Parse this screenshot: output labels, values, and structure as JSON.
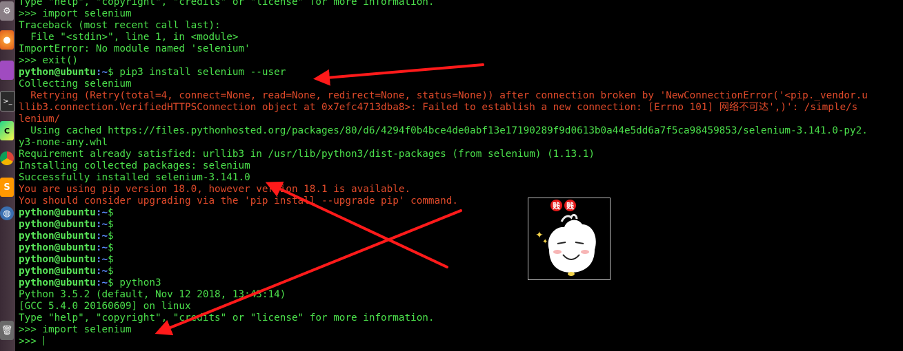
{
  "launcher": {
    "icons": [
      "settings-icon",
      "firefox-icon",
      "purple-app-icon",
      "terminal-app-icon",
      "pycharm-icon",
      "chrome-icon",
      "sublime-icon",
      "network-icon",
      "trash-icon"
    ]
  },
  "terminal": {
    "user_host": "python@ubuntu",
    "path_sep": ":~",
    "lines": [
      [
        {
          "t": "Type \"help\", \"copyright\", \"credits\" or \"license\" for more information.",
          "c": "default"
        }
      ],
      [
        {
          "t": ">>> import selenium",
          "c": "default"
        }
      ],
      [
        {
          "t": "Traceback (most recent call last):",
          "c": "default"
        }
      ],
      [
        {
          "t": "  File \"<stdin>\", line 1, in <module>",
          "c": "default"
        }
      ],
      [
        {
          "t": "ImportError: No module named 'selenium'",
          "c": "default"
        }
      ],
      [
        {
          "t": ">>> exit()",
          "c": "default"
        }
      ],
      [
        {
          "t": "python@ubuntu",
          "c": "user"
        },
        {
          "t": ":~",
          "c": "path"
        },
        {
          "t": "$ pip3 install selenium --user",
          "c": "default"
        }
      ],
      [
        {
          "t": "Collecting selenium",
          "c": "default"
        }
      ],
      [
        {
          "t": "  Retrying (Retry(total=4, connect=None, read=None, redirect=None, status=None)) after connection broken by 'NewConnectionError('<pip._vendor.u",
          "c": "warn"
        }
      ],
      [
        {
          "t": "llib3.connection.VerifiedHTTPSConnection object at 0x7efc4713dba8>: Failed to establish a new connection: [Errno 101] 网络不可达',)': /simple/s",
          "c": "warn"
        }
      ],
      [
        {
          "t": "lenium/",
          "c": "warn"
        }
      ],
      [
        {
          "t": "  Using cached https://files.pythonhosted.org/packages/80/d6/4294f0b4bce4de0abf13e17190289f9d0613b0a44e5dd6a7f5ca98459853/selenium-3.141.0-py2.",
          "c": "default"
        }
      ],
      [
        {
          "t": "y3-none-any.whl",
          "c": "default"
        }
      ],
      [
        {
          "t": "Requirement already satisfied: urllib3 in /usr/lib/python3/dist-packages (from selenium) (1.13.1)",
          "c": "default"
        }
      ],
      [
        {
          "t": "Installing collected packages: selenium",
          "c": "default"
        }
      ],
      [
        {
          "t": "Successfully installed selenium-3.141.0",
          "c": "default"
        }
      ],
      [
        {
          "t": "You are using pip version 18.0, however version 18.1 is available.",
          "c": "warn"
        }
      ],
      [
        {
          "t": "You should consider upgrading via the 'pip install --upgrade pip' command.",
          "c": "warn"
        }
      ],
      [
        {
          "t": "python@ubuntu",
          "c": "user"
        },
        {
          "t": ":~",
          "c": "path"
        },
        {
          "t": "$",
          "c": "default"
        }
      ],
      [
        {
          "t": "python@ubuntu",
          "c": "user"
        },
        {
          "t": ":~",
          "c": "path"
        },
        {
          "t": "$",
          "c": "default"
        }
      ],
      [
        {
          "t": "python@ubuntu",
          "c": "user"
        },
        {
          "t": ":~",
          "c": "path"
        },
        {
          "t": "$",
          "c": "default"
        }
      ],
      [
        {
          "t": "python@ubuntu",
          "c": "user"
        },
        {
          "t": ":~",
          "c": "path"
        },
        {
          "t": "$",
          "c": "default"
        }
      ],
      [
        {
          "t": "python@ubuntu",
          "c": "user"
        },
        {
          "t": ":~",
          "c": "path"
        },
        {
          "t": "$",
          "c": "default"
        }
      ],
      [
        {
          "t": "python@ubuntu",
          "c": "user"
        },
        {
          "t": ":~",
          "c": "path"
        },
        {
          "t": "$",
          "c": "default"
        }
      ],
      [
        {
          "t": "python@ubuntu",
          "c": "user"
        },
        {
          "t": ":~",
          "c": "path"
        },
        {
          "t": "$ python3",
          "c": "default"
        }
      ],
      [
        {
          "t": "Python 3.5.2 (default, Nov 12 2018, 13:43:14)",
          "c": "default"
        }
      ],
      [
        {
          "t": "[GCC 5.4.0 20160609] on linux",
          "c": "default"
        }
      ],
      [
        {
          "t": "Type \"help\", \"copyright\", \"credits\" or \"license\" for more information.",
          "c": "default"
        }
      ],
      [
        {
          "t": ">>> import selenium",
          "c": "default"
        }
      ],
      [
        {
          "t": ">>> ",
          "c": "default"
        },
        {
          "t": "",
          "c": "cursor"
        }
      ]
    ]
  },
  "sticker": {
    "badge_1": "贱",
    "badge_2": "贱",
    "sparkle": "✦"
  },
  "colors": {
    "terminal_fg": "#4be04b",
    "warn_fg": "#e04a2a",
    "path_fg": "#5c8cff",
    "annotation": "#ff1a1a"
  }
}
